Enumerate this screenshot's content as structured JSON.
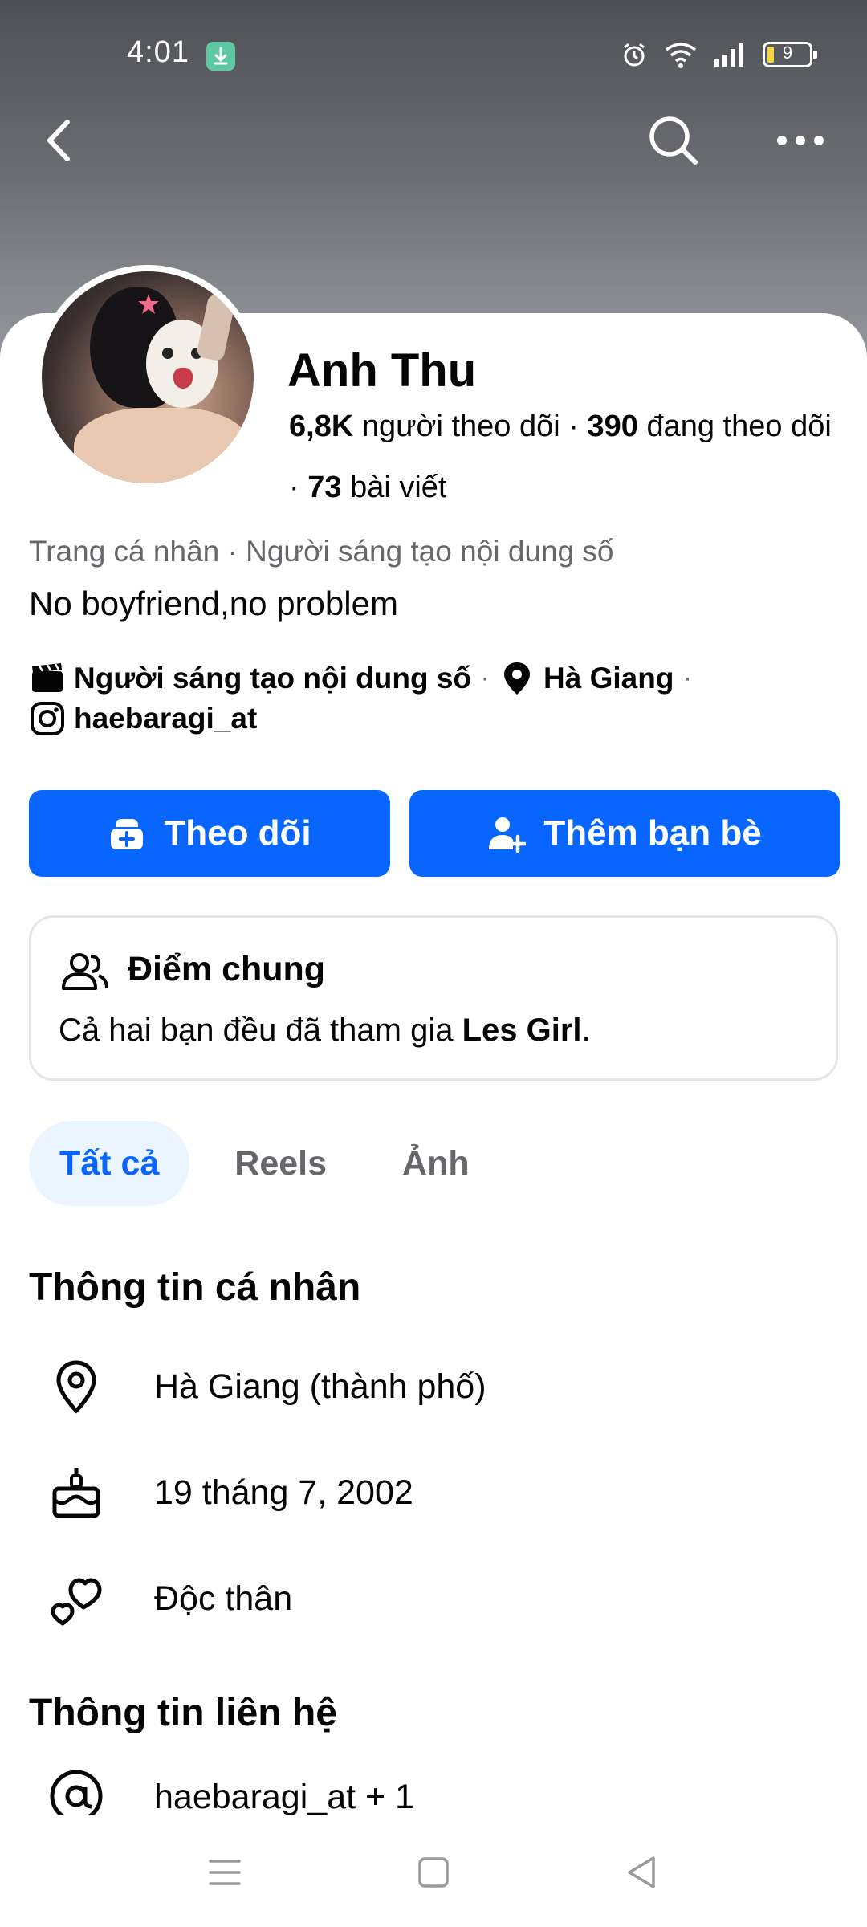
{
  "status_bar": {
    "time": "4:01",
    "battery": "9"
  },
  "profile": {
    "name": "Anh Thu",
    "followers_count": "6,8K",
    "followers_label": "người theo dõi",
    "following_count": "390",
    "following_label": "đang theo dõi",
    "posts_count": "73",
    "posts_label": "bài viết",
    "category": "Trang cá nhân · Người sáng tạo nội dung số",
    "bio": "No boyfriend,no problem",
    "creator_label": "Người sáng tạo nội dung số",
    "location_label": "Hà Giang",
    "instagram": "haebaragi_at"
  },
  "actions": {
    "follow_label": "Theo dõi",
    "add_friend_label": "Thêm bạn bè"
  },
  "common": {
    "title": "Điểm chung",
    "text_prefix": "Cả hai bạn đều đã tham gia ",
    "group": "Les Girl",
    "text_suffix": "."
  },
  "tabs": [
    {
      "label": "Tất cả",
      "active": true
    },
    {
      "label": "Reels",
      "active": false
    },
    {
      "label": "Ảnh",
      "active": false
    }
  ],
  "personal_info": {
    "title": "Thông tin cá nhân",
    "items": [
      {
        "icon": "location-pin-icon",
        "text": "Hà Giang (thành phố)"
      },
      {
        "icon": "birthday-cake-icon",
        "text": "19 tháng 7, 2002"
      },
      {
        "icon": "hearts-icon",
        "text": "Độc thân"
      }
    ]
  },
  "contact_info": {
    "title": "Thông tin liên hệ",
    "items": [
      {
        "icon": "at-sign-icon",
        "text": "haebaragi_at + 1"
      }
    ]
  },
  "colors": {
    "primary": "#0866ff",
    "secondary_text": "#65676b",
    "tab_active_bg": "#ebf5ff"
  }
}
